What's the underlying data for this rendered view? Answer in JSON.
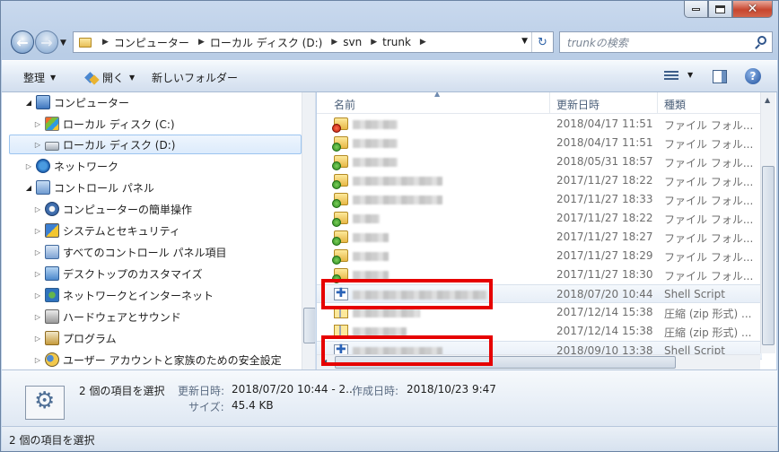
{
  "address": {
    "crumbs": [
      "コンピューター",
      "ローカル ディスク (D:)",
      "svn",
      "trunk"
    ]
  },
  "search": {
    "placeholder": "trunkの検索"
  },
  "toolbar": {
    "organize": "整理",
    "open": "開く",
    "new_folder": "新しいフォルダー"
  },
  "navpane": {
    "items": [
      {
        "label": "コンピューター",
        "icon": "computer-icon",
        "expanded": true
      },
      {
        "label": "ローカル ディスク (C:)",
        "icon": "disk-c-icon"
      },
      {
        "label": "ローカル ディスク (D:)",
        "icon": "disk-d-icon",
        "selected": true
      },
      {
        "label": "ネットワーク",
        "icon": "network-icon"
      },
      {
        "label": "コントロール パネル",
        "icon": "control-panel-icon",
        "expanded": true
      },
      {
        "label": "コンピューターの簡単操作",
        "icon": "ease-of-access-icon"
      },
      {
        "label": "システムとセキュリティ",
        "icon": "system-security-icon"
      },
      {
        "label": "すべてのコントロール パネル項目",
        "icon": "all-items-icon"
      },
      {
        "label": "デスクトップのカスタマイズ",
        "icon": "desktop-customize-icon"
      },
      {
        "label": "ネットワークとインターネット",
        "icon": "network-internet-icon"
      },
      {
        "label": "ハードウェアとサウンド",
        "icon": "hardware-sound-icon"
      },
      {
        "label": "プログラム",
        "icon": "programs-icon"
      },
      {
        "label": "ユーザー アカウントと家族のための安全設定",
        "icon": "user-accounts-icon"
      }
    ]
  },
  "filelist": {
    "columns": {
      "name": "名前",
      "date": "更新日時",
      "type": "種類"
    },
    "rows": [
      {
        "kind": "folder-warn",
        "date": "2018/04/17 11:51",
        "type": "ファイル フォル..."
      },
      {
        "kind": "folder-ok",
        "date": "2018/04/17 11:51",
        "type": "ファイル フォル..."
      },
      {
        "kind": "folder-ok",
        "date": "2018/05/31 18:57",
        "type": "ファイル フォル..."
      },
      {
        "kind": "folder-ok",
        "date": "2017/11/27 18:22",
        "type": "ファイル フォル..."
      },
      {
        "kind": "folder-ok",
        "date": "2017/11/27 18:33",
        "type": "ファイル フォル..."
      },
      {
        "kind": "folder-ok",
        "date": "2017/11/27 18:22",
        "type": "ファイル フォル..."
      },
      {
        "kind": "folder-ok",
        "date": "2017/11/27 18:27",
        "type": "ファイル フォル..."
      },
      {
        "kind": "folder-ok",
        "date": "2017/11/27 18:29",
        "type": "ファイル フォル..."
      },
      {
        "kind": "folder-ok",
        "date": "2017/11/27 18:30",
        "type": "ファイル フォル..."
      },
      {
        "kind": "script",
        "date": "2018/07/20 10:44",
        "type": "Shell Script",
        "selected": true
      },
      {
        "kind": "zip",
        "date": "2017/12/14 15:38",
        "type": "圧縮 (zip 形式) ..."
      },
      {
        "kind": "zip",
        "date": "2017/12/14 15:38",
        "type": "圧縮 (zip 形式) ..."
      },
      {
        "kind": "script",
        "date": "2018/09/10 13:38",
        "type": "Shell Script",
        "selected": true
      }
    ]
  },
  "details": {
    "count": "2 個の項目を選択",
    "modified_label": "更新日時:",
    "modified_value": "2018/07/20 10:44 - 2...",
    "created_label": "作成日時:",
    "created_value": "2018/10/23 9:47",
    "size_label": "サイズ:",
    "size_value": "45.4 KB"
  },
  "status": {
    "text": "2 個の項目を選択"
  },
  "colors": {
    "highlight": "#e60000",
    "selection": "#dcebfc"
  }
}
